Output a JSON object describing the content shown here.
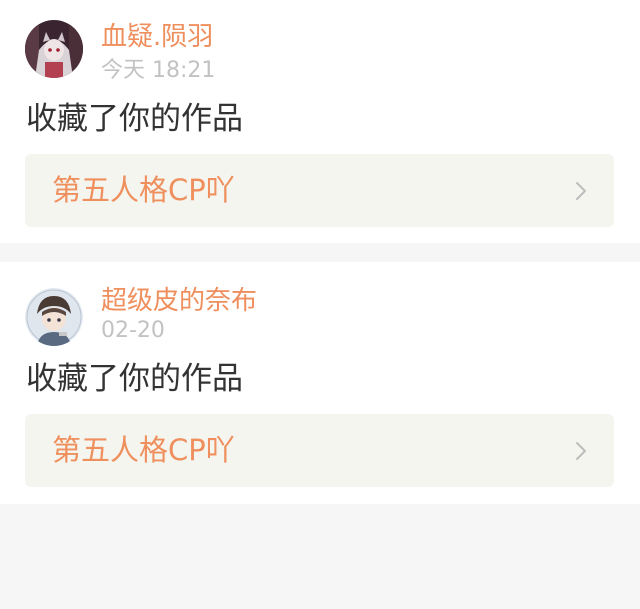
{
  "notifications": [
    {
      "username": "血疑.陨羽",
      "time": "今天 18:21",
      "action": "收藏了你的作品",
      "work_title": "第五人格CP吖",
      "avatar_icon": "avatar-anime-girl-icon"
    },
    {
      "username": "超级皮的奈布",
      "time": "02-20",
      "action": "收藏了你的作品",
      "work_title": "第五人格CP吖",
      "avatar_icon": "avatar-anime-boy-icon"
    }
  ],
  "colors": {
    "accent": "#ef8f5d",
    "timestamp": "#c2c2c2",
    "body_text": "#333333",
    "link_bg": "#f5f5f0",
    "page_bg": "#f6f6f6"
  }
}
